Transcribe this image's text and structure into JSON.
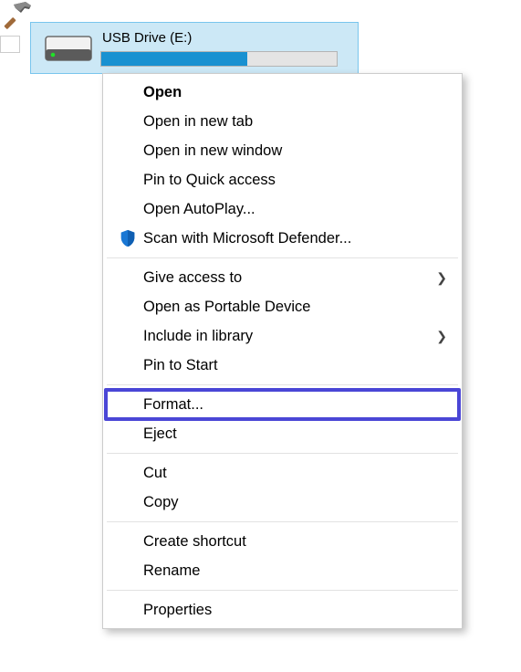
{
  "drive": {
    "label": "USB Drive (E:)",
    "usage_percent": 62
  },
  "menu": {
    "groups": [
      [
        {
          "id": "open",
          "label": "Open",
          "bold": true,
          "submenu": false,
          "icon": null
        },
        {
          "id": "open-new-tab",
          "label": "Open in new tab",
          "bold": false,
          "submenu": false,
          "icon": null
        },
        {
          "id": "open-new-window",
          "label": "Open in new window",
          "bold": false,
          "submenu": false,
          "icon": null
        },
        {
          "id": "pin-quick-access",
          "label": "Pin to Quick access",
          "bold": false,
          "submenu": false,
          "icon": null
        },
        {
          "id": "open-autoplay",
          "label": "Open AutoPlay...",
          "bold": false,
          "submenu": false,
          "icon": null
        },
        {
          "id": "scan-defender",
          "label": "Scan with Microsoft Defender...",
          "bold": false,
          "submenu": false,
          "icon": "shield"
        }
      ],
      [
        {
          "id": "give-access",
          "label": "Give access to",
          "bold": false,
          "submenu": true,
          "icon": null
        },
        {
          "id": "open-portable",
          "label": "Open as Portable Device",
          "bold": false,
          "submenu": false,
          "icon": null
        },
        {
          "id": "include-library",
          "label": "Include in library",
          "bold": false,
          "submenu": true,
          "icon": null
        },
        {
          "id": "pin-start",
          "label": "Pin to Start",
          "bold": false,
          "submenu": false,
          "icon": null
        }
      ],
      [
        {
          "id": "format",
          "label": "Format...",
          "bold": false,
          "submenu": false,
          "icon": null,
          "highlighted": true
        },
        {
          "id": "eject",
          "label": "Eject",
          "bold": false,
          "submenu": false,
          "icon": null
        }
      ],
      [
        {
          "id": "cut",
          "label": "Cut",
          "bold": false,
          "submenu": false,
          "icon": null
        },
        {
          "id": "copy",
          "label": "Copy",
          "bold": false,
          "submenu": false,
          "icon": null
        }
      ],
      [
        {
          "id": "create-shortcut",
          "label": "Create shortcut",
          "bold": false,
          "submenu": false,
          "icon": null
        },
        {
          "id": "rename",
          "label": "Rename",
          "bold": false,
          "submenu": false,
          "icon": null
        }
      ],
      [
        {
          "id": "properties",
          "label": "Properties",
          "bold": false,
          "submenu": false,
          "icon": null
        }
      ]
    ]
  }
}
